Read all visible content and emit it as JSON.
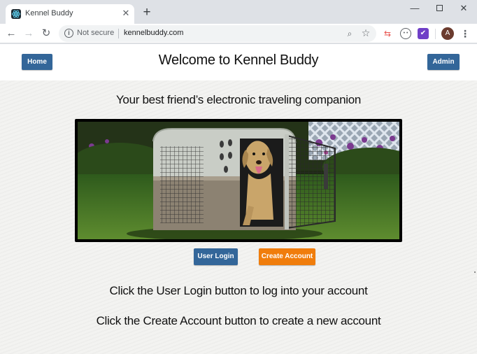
{
  "browser": {
    "tab": {
      "title": "Kennel Buddy",
      "close": "✕",
      "favicon": "react-atom-icon"
    },
    "new_tab": "+",
    "window_controls": {
      "minimize": "—",
      "close": "✕"
    },
    "nav": {
      "back": "←",
      "forward": "→",
      "reload": "↻"
    },
    "omnibox": {
      "security_label": "Not secure",
      "url": "kennelbuddy.com",
      "info": "i"
    },
    "toolbar_icons": {
      "zoom": "⌕",
      "star": "☆",
      "menu": "⋮"
    },
    "extensions": {
      "ext1": "⇆",
      "ext2": "• •",
      "ext3": "✔"
    },
    "profile_initial": "A"
  },
  "page": {
    "header": {
      "home_label": "Home",
      "title": "Welcome to Kennel Buddy",
      "admin_label": "Admin"
    },
    "tagline": "Your best friend’s electronic traveling companion",
    "hero_image": "dog-in-travel-kennel",
    "buttons": {
      "user_login": "User Login",
      "create_account": "Create Account"
    },
    "info_login": "Click the User Login button to log into your account",
    "info_create": "Click the Create Account button to create a new account"
  },
  "colors": {
    "primary_button": "#336699",
    "accent_button": "#f07d0c"
  }
}
